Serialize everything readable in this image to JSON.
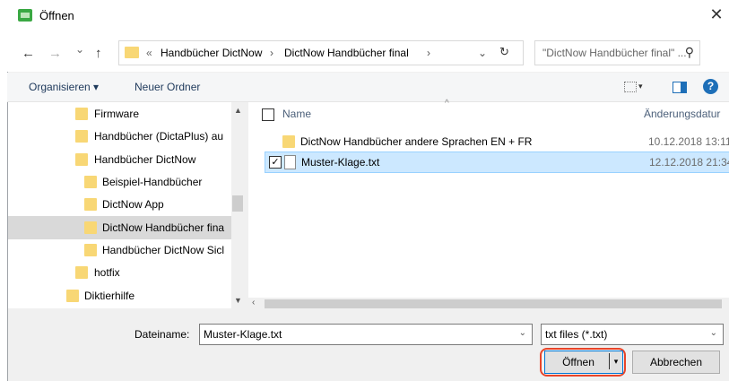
{
  "window": {
    "title": "Öffnen",
    "close": "✕"
  },
  "nav": {
    "back": "←",
    "forward": "→",
    "recent": "⌄",
    "up": "↑",
    "refresh": "↻",
    "dropdown": "⌄"
  },
  "address": {
    "overflow": "«",
    "seg1": "Handbücher DictNow",
    "sep1": "›",
    "seg2": "DictNow Handbücher final",
    "sep2": "›"
  },
  "search": {
    "placeholder": "\"DictNow Handbücher final\" ...",
    "icon": "⚲"
  },
  "toolbar": {
    "organize": "Organisieren ▾",
    "new_folder": "Neuer Ordner"
  },
  "tree": {
    "items": [
      {
        "label": "Firmware"
      },
      {
        "label": "Handbücher (DictaPlus) au"
      },
      {
        "label": "Handbücher DictNow"
      },
      {
        "label": "Beispiel-Handbücher"
      },
      {
        "label": "DictNow App"
      },
      {
        "label": "DictNow Handbücher fina"
      },
      {
        "label": "Handbücher DictNow Sicl"
      },
      {
        "label": "hotfix"
      },
      {
        "label": "Diktierhilfe"
      }
    ]
  },
  "columns": {
    "name": "Name",
    "date": "Änderungsdatur"
  },
  "files": [
    {
      "name": "DictNow Handbücher andere Sprachen EN + FR",
      "date": "10.12.2018 13:11",
      "type": "folder",
      "selected": false
    },
    {
      "name": "Muster-Klage.txt",
      "date": "12.12.2018 21:34",
      "type": "file",
      "selected": true
    }
  ],
  "footer": {
    "filename_label": "Dateiname:",
    "filename_value": "Muster-Klage.txt",
    "filter": "txt files (*.txt)",
    "open": "Öffnen",
    "cancel": "Abbrechen"
  },
  "colors": {
    "accent": "#0078d7",
    "folder": "#f8d775",
    "selection": "#cce8ff",
    "highlight": "#e8452a"
  }
}
